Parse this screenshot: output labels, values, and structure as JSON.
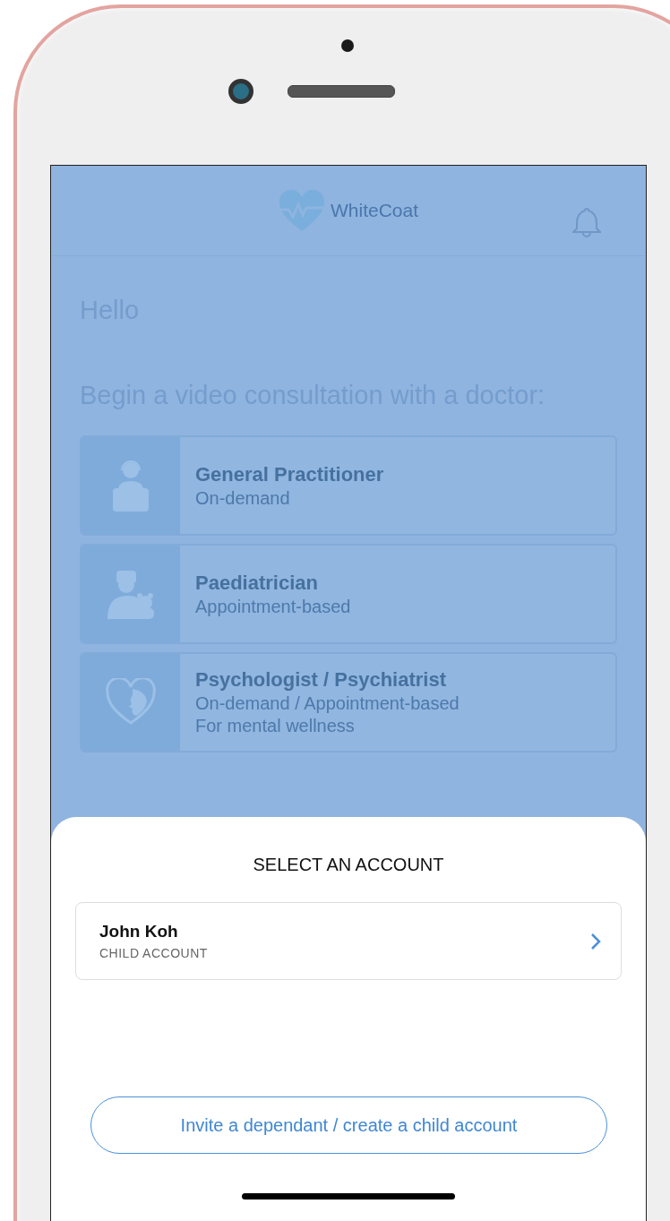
{
  "app_bar": {
    "logo_text": "WhiteCoat"
  },
  "greeting": "Hello",
  "prompt": "Begin a video consultation with a doctor:",
  "services": [
    {
      "kind": "gp",
      "title": "General Practitioner",
      "lines": [
        "On-demand"
      ]
    },
    {
      "kind": "paediatric",
      "title": "Paediatrician",
      "lines": [
        "Appointment-based"
      ]
    },
    {
      "kind": "mental",
      "title": "Psychologist / Psychiatrist",
      "lines": [
        "On-demand / Appointment-based",
        "For mental wellness"
      ]
    }
  ],
  "account_sheet": {
    "title": "SELECT AN ACCOUNT",
    "accounts": [
      {
        "name": "John Koh",
        "type": "CHILD ACCOUNT"
      }
    ],
    "invite_button": "Invite a dependant / create a child account"
  }
}
